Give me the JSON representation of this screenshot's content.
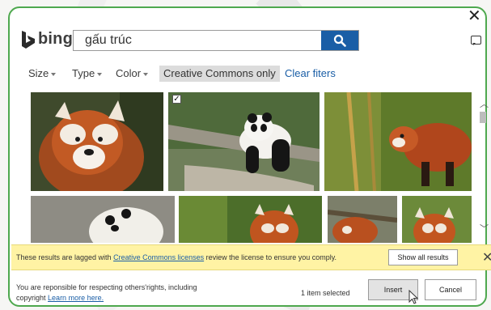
{
  "window": {
    "close_label": "✕"
  },
  "brand": {
    "name": "bing",
    "color": "#2b2b2b"
  },
  "search": {
    "query": "gấu trúc",
    "button_icon": "search-icon",
    "accent": "#1a5ea6"
  },
  "filters": {
    "size_label": "Size",
    "type_label": "Type",
    "color_label": "Color",
    "cc_only_label": "Creative Commons only",
    "clear_label": "Clear fiters"
  },
  "results": {
    "images": [
      {
        "subject": "red panda close-up",
        "selected": false
      },
      {
        "subject": "giant panda on log",
        "selected": true
      },
      {
        "subject": "red panda on branch",
        "selected": false
      },
      {
        "subject": "giant panda",
        "selected": false
      },
      {
        "subject": "red panda",
        "selected": false
      },
      {
        "subject": "red panda",
        "selected": false
      },
      {
        "subject": "red panda",
        "selected": false
      }
    ]
  },
  "notice": {
    "text_before": "These results are lagged with",
    "link_text": "Creative Commons licenses",
    "text_after": "review the license to ensure you comply.",
    "show_all_label": "Show all results",
    "close_label": "✕",
    "background": "#fff3a4"
  },
  "footer": {
    "line1": "You are reponsible for respecting others'rights, including",
    "line2_prefix": "copyright",
    "learn_more": "Learn more here.",
    "selected_count": "1 item selected",
    "insert_label": "Insert",
    "cancel_label": "Cancel"
  }
}
